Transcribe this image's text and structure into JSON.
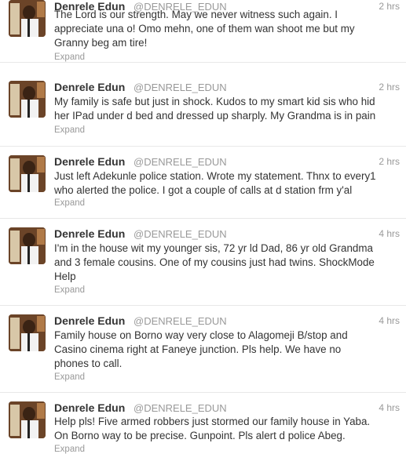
{
  "tweets": [
    {
      "fullname": "Denrele Edun",
      "username": "@DENRELE_EDUN",
      "time": "2 hrs",
      "text": "The Lord is our strength. May we never witness such again. I\nappreciate una o! Omo mehn, one of them wan shoot me but my\nGranny beg am tire!",
      "expand": "Expand"
    },
    {
      "fullname": "Denrele Edun",
      "username": "@DENRELE_EDUN",
      "time": "2 hrs",
      "text": "My family is safe but just in shock. Kudos to my smart kid sis who hid\nher IPad under d bed and dressed up sharply. My Grandma is in pain",
      "expand": "Expand"
    },
    {
      "fullname": "Denrele Edun",
      "username": "@DENRELE_EDUN",
      "time": "2 hrs",
      "text": "Just left Adekunle police station. Wrote my statement. Thnx to every1\nwho alerted the police. I got a couple of calls at d station frm y'al",
      "expand": "Expand"
    },
    {
      "fullname": "Denrele Edun",
      "username": "@DENRELE_EDUN",
      "time": "4 hrs",
      "text": "I'm in the house wit my younger sis, 72 yr ld Dad, 86 yr old Grandma\nand 3 female cousins. One of my cousins just had twins. ShockMode\nHelp",
      "expand": "Expand"
    },
    {
      "fullname": "Denrele Edun",
      "username": "@DENRELE_EDUN",
      "time": "4 hrs",
      "text": "Family house on Borno way very close to Alagomeji B/stop and\nCasino cinema right at Faneye junction. Pls help. We have no\nphones to call.",
      "expand": "Expand"
    },
    {
      "fullname": "Denrele Edun",
      "username": "@DENRELE_EDUN",
      "time": "4 hrs",
      "text": "Help pls! Five armed robbers just stormed our family house in Yaba.\nOn Borno way to be precise. Gunpoint. Pls alert d police Abeg.",
      "expand": "Expand"
    }
  ]
}
